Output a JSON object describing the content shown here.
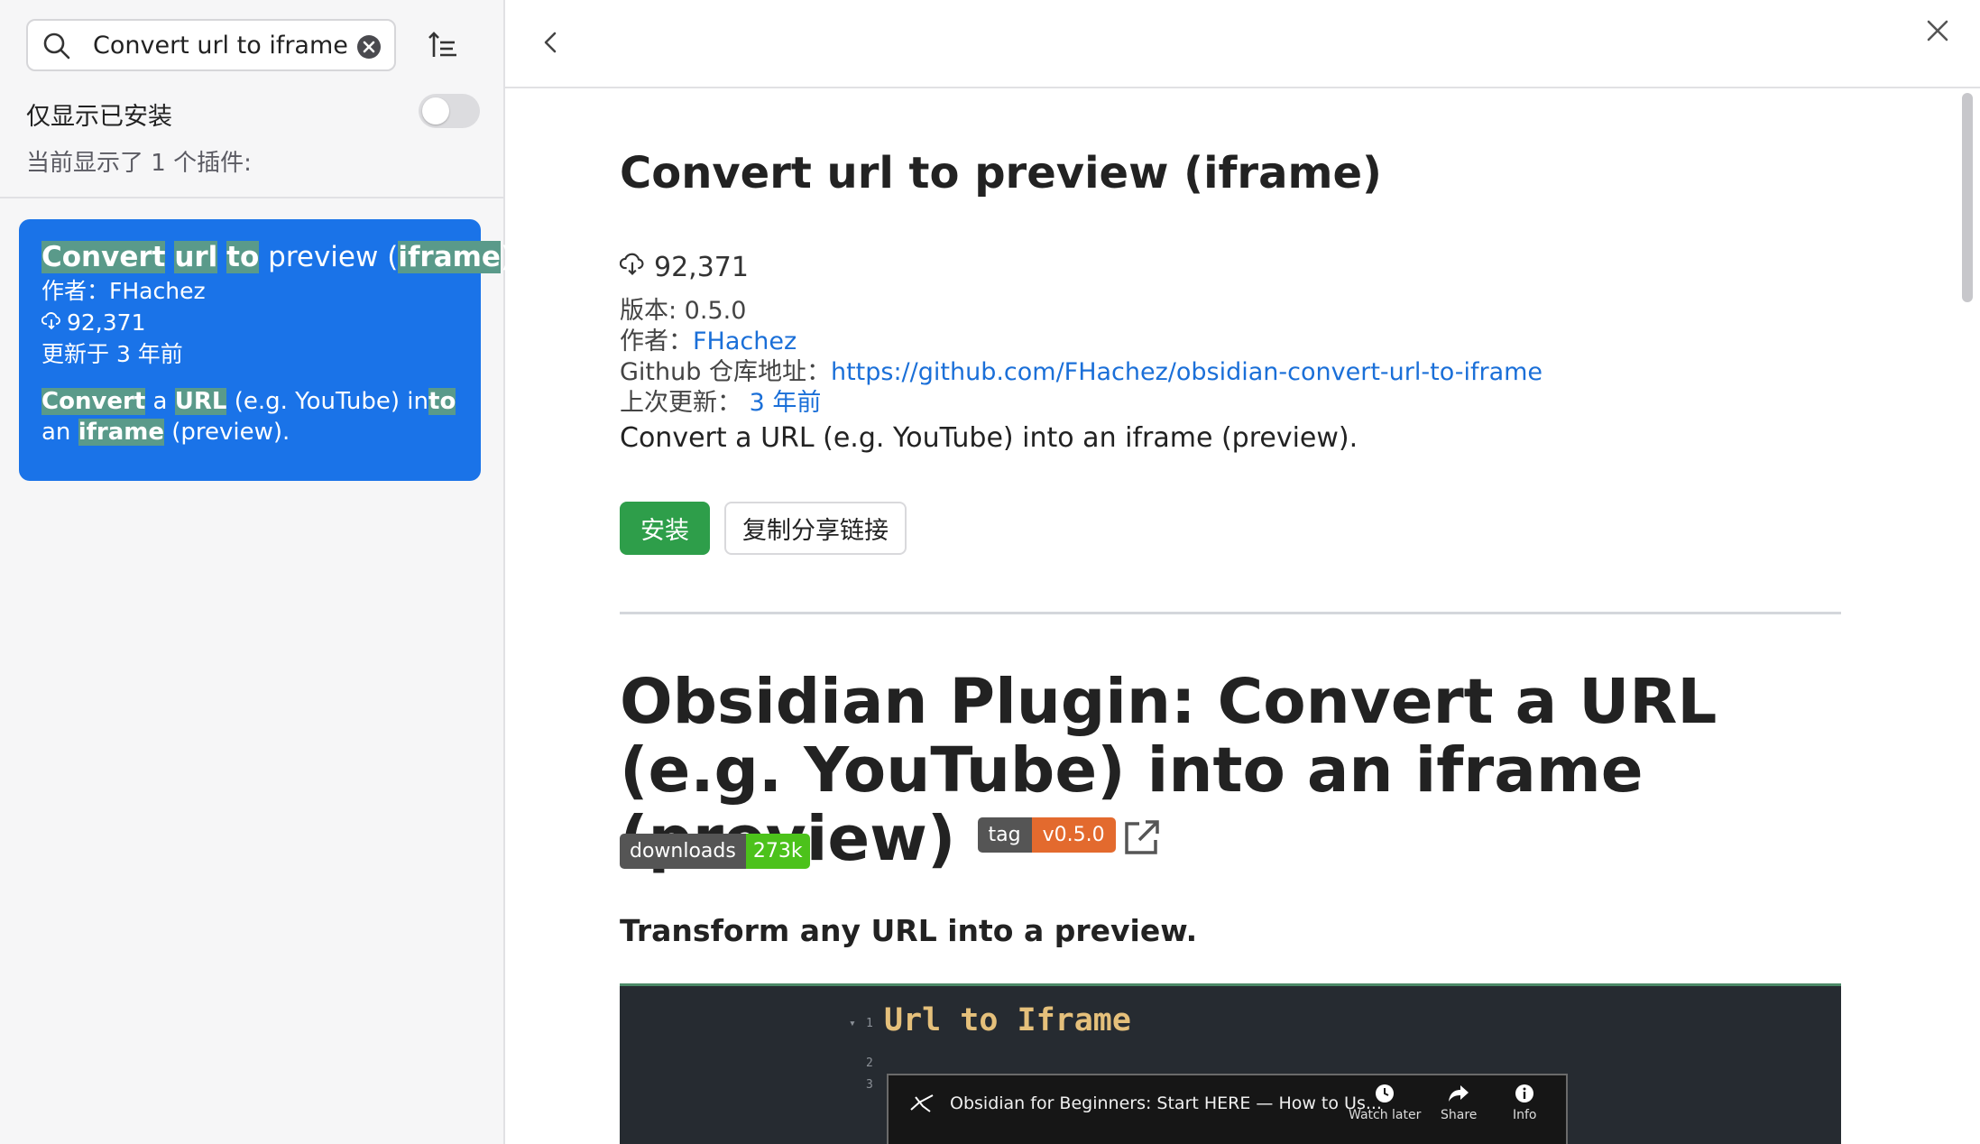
{
  "sidebar": {
    "search": {
      "value": "Convert url to iframe",
      "placeholder": ""
    },
    "installed_only_label": "仅显示已安装",
    "installed_only_checked": false,
    "count_text": "当前显示了 1 个插件:",
    "plugin_card": {
      "title_parts": [
        "Convert",
        " ",
        "url",
        " ",
        "to",
        " preview (",
        "iframe",
        ")"
      ],
      "author": "作者：FHachez",
      "downloads": "92,371",
      "updated": "更新于 3 年前",
      "description_parts": [
        "Convert",
        " a ",
        "URL",
        " (e.g. YouTube) in",
        "to",
        "an",
        " ",
        "iframe",
        " (preview)."
      ]
    }
  },
  "detail": {
    "title": "Convert url to preview (iframe)",
    "downloads": "92,371",
    "version": "版本: 0.5.0",
    "author_label": "作者：",
    "author": "FHachez",
    "github_label": "Github 仓库地址：",
    "github_url": "https://github.com/FHachez/obsidian-convert-url-to-iframe",
    "updated_label": "上次更新：",
    "updated": "3 年前",
    "description": "Convert a URL (e.g. YouTube) into an iframe (preview).",
    "install_label": "安装",
    "copy_link_label": "复制分享链接"
  },
  "readme": {
    "heading": "Obsidian Plugin: Convert a URL (e.g. YouTube) into an iframe (preview)",
    "tag_badge": {
      "label": "tag",
      "value": "v0.5.0"
    },
    "downloads_badge": {
      "label": "downloads",
      "value": "273k"
    },
    "subheading": "Transform any URL into a preview.",
    "preview": {
      "line_numbers": [
        "1",
        "2",
        "3"
      ],
      "heading": "Url to Iframe",
      "video_title": "Obsidian for Beginners: Start HERE — How to Us...",
      "controls": [
        "Watch later",
        "Share",
        "Info"
      ]
    }
  },
  "colors": {
    "accent": "#1a73e8",
    "install_green": "#2e9e4a",
    "link": "#1a6fd8",
    "badge_tag": "#e36a2e",
    "badge_downloads": "#4cc21b"
  },
  "icons": [
    "search-icon",
    "clear-icon",
    "sort-icon",
    "download-icon",
    "back-icon",
    "close-icon",
    "external-link-icon",
    "obsidian-logo-icon",
    "clock-icon",
    "share-icon",
    "info-icon"
  ]
}
